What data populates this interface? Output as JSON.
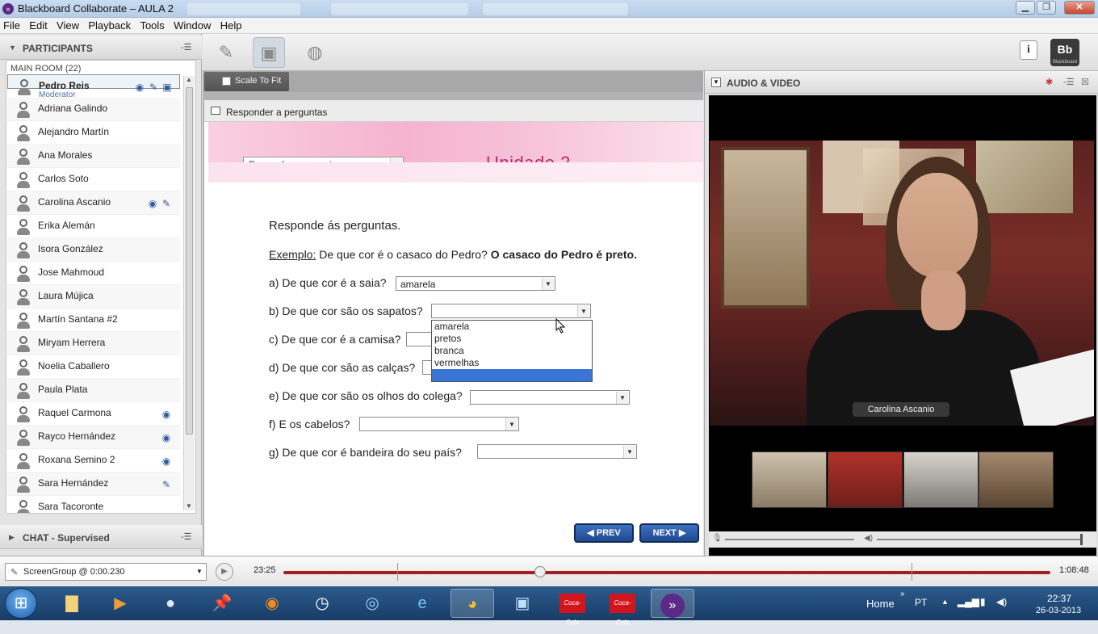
{
  "window": {
    "title": "Blackboard Collaborate – AULA 2",
    "controls": [
      "minimize",
      "maximize",
      "close"
    ],
    "close_label": "✕"
  },
  "menu": [
    "File",
    "Edit",
    "View",
    "Playback",
    "Tools",
    "Window",
    "Help"
  ],
  "participants_panel": {
    "title": "PARTICIPANTS",
    "room": "MAIN ROOM",
    "count": "(22)",
    "participants": [
      {
        "name": "Pedro Reis",
        "role": "Moderator",
        "icons": [
          "eye-icon",
          "mic-icon",
          "screen-icon"
        ]
      },
      {
        "name": "Adriana Galindo",
        "icons": []
      },
      {
        "name": "Alejandro Martín",
        "icons": []
      },
      {
        "name": "Ana Morales",
        "icons": []
      },
      {
        "name": "Carlos Soto",
        "icons": []
      },
      {
        "name": "Carolina Ascanio",
        "icons": [
          "eye-icon",
          "mic-icon"
        ]
      },
      {
        "name": "Erika Alemán",
        "icons": []
      },
      {
        "name": "Isora González",
        "icons": []
      },
      {
        "name": "Jose Mahmoud",
        "icons": []
      },
      {
        "name": "Laura Mújica",
        "icons": []
      },
      {
        "name": "Martín Santana #2",
        "icons": []
      },
      {
        "name": "Miryam Herrera",
        "icons": []
      },
      {
        "name": "Noelia Caballero",
        "icons": []
      },
      {
        "name": "Paula Plata",
        "icons": []
      },
      {
        "name": "Raquel Carmona",
        "icons": [
          "eye-icon"
        ]
      },
      {
        "name": "Rayco Hernández",
        "icons": [
          "eye-icon"
        ]
      },
      {
        "name": "Roxana Semino 2",
        "icons": [
          "eye-icon"
        ]
      },
      {
        "name": "Sara Hernández",
        "icons": [
          "mic-icon"
        ]
      },
      {
        "name": "Sara Tacoronte",
        "icons": []
      }
    ]
  },
  "chat_panel": {
    "title": "CHAT - Supervised"
  },
  "toolbar": {
    "scale_to_fit": "Scale To Fit",
    "logo": "Bb",
    "logo_sub": "Blackboard",
    "info": "i"
  },
  "document": {
    "window_title": "Responder a perguntas",
    "page_select": "Responder a perguntas",
    "unit_title": "Unidade 2",
    "instruction": "Responde ás perguntas.",
    "example_label": "Exemplo:",
    "example_question": "De que cor é o casaco do Pedro?",
    "example_answer": "O casaco do Pedro é preto.",
    "questions": [
      {
        "text": "a) De que cor é a saia?",
        "value": "amarela"
      },
      {
        "text": "b) De que cor são os sapatos?",
        "value": ""
      },
      {
        "text": "c) De que cor é a camisa?",
        "value": ""
      },
      {
        "text": "d) De que cor são as calças?",
        "value": ""
      },
      {
        "text": "e) De que cor são os olhos do colega?",
        "value": ""
      },
      {
        "text": "f) E os cabelos?",
        "value": ""
      },
      {
        "text": "g) De que cor é  bandeira do seu país?",
        "value": ""
      }
    ],
    "dropdown_options": [
      "amarela",
      "pretos",
      "branca",
      "vermelhas",
      ""
    ],
    "prev": "PREV",
    "next": "NEXT"
  },
  "audio_video": {
    "title": "AUDIO & VIDEO",
    "camera_name": "Carolina Ascanio"
  },
  "playback": {
    "screen_group": "ScreenGroup @ 0:00.230",
    "current_time": "23:25",
    "end_time": "1:08:48",
    "progress": 0.335
  },
  "taskbar": {
    "home": "Home",
    "lang": "PT",
    "time": "22:37",
    "date": "26-03-2013",
    "coca1": "Coca-Cola",
    "coca2": "Coca-Cola"
  }
}
